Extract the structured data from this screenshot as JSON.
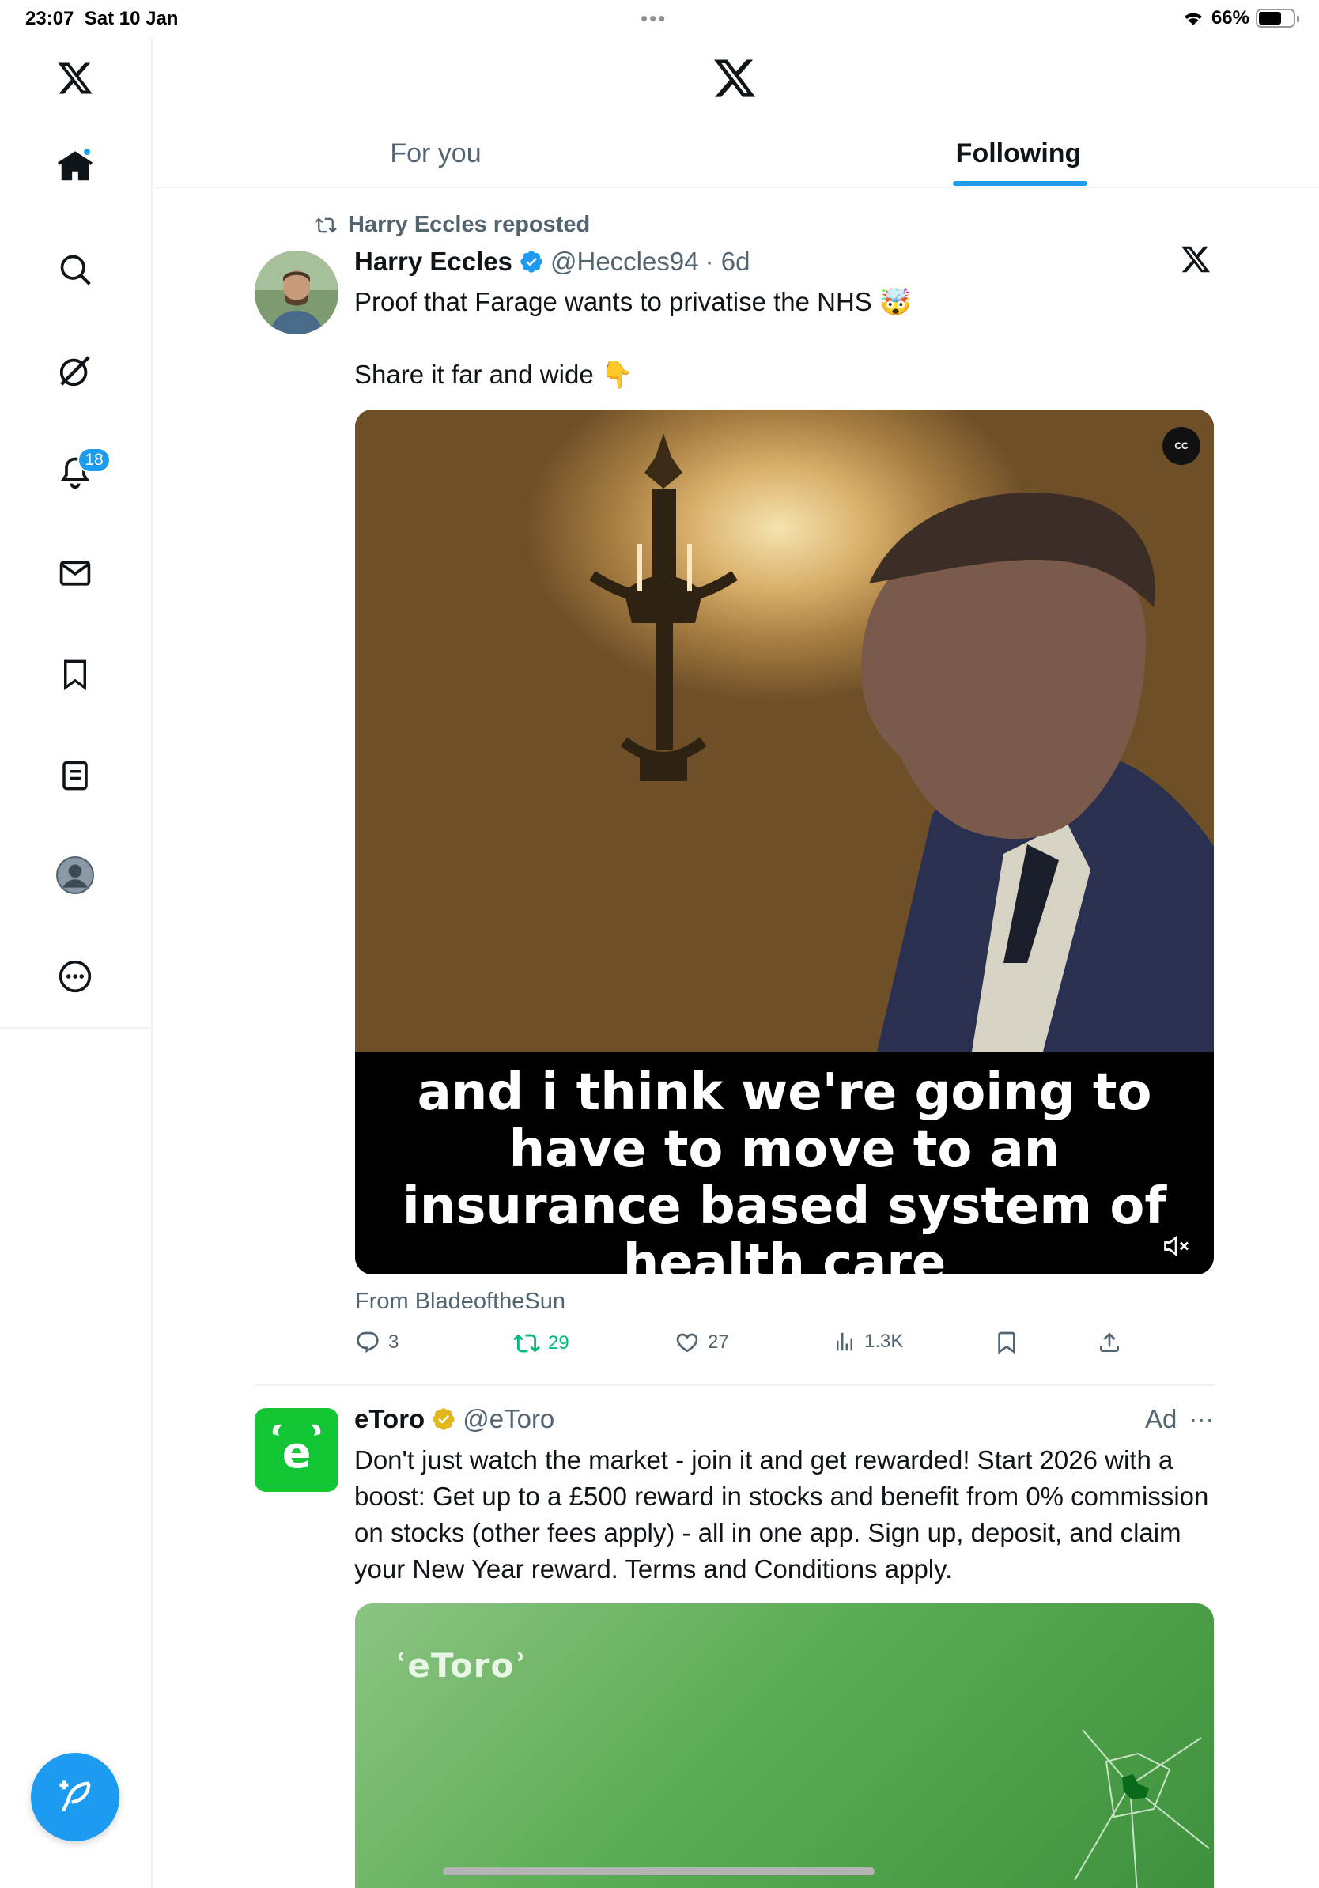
{
  "status_bar": {
    "time": "23:07",
    "date": "Sat 10 Jan",
    "battery": "66%",
    "battery_level": 0.66
  },
  "sidebar": {
    "items": [
      {
        "name": "logo",
        "icon": "x-logo-icon"
      },
      {
        "name": "home",
        "icon": "home-icon",
        "has_dot": true
      },
      {
        "name": "explore",
        "icon": "search-icon"
      },
      {
        "name": "grok",
        "icon": "grok-icon"
      },
      {
        "name": "notifications",
        "icon": "bell-icon",
        "badge": "18"
      },
      {
        "name": "messages",
        "icon": "mail-icon"
      },
      {
        "name": "bookmarks",
        "icon": "bookmark-icon"
      },
      {
        "name": "lists",
        "icon": "list-icon"
      },
      {
        "name": "profile",
        "icon": "avatar-icon"
      },
      {
        "name": "more",
        "icon": "more-circle-icon"
      }
    ],
    "compose_icon": "compose-feather-icon"
  },
  "header": {
    "tabs": [
      {
        "label": "For you",
        "active": false
      },
      {
        "label": "Following",
        "active": true
      }
    ],
    "accent": "#1d9bf0"
  },
  "tweets": [
    {
      "repost_label": "Harry Eccles reposted",
      "author": "Harry Eccles",
      "handle": "@Heccles94",
      "time": "· 6d",
      "verified": true,
      "line1": "Proof that Farage wants to privatise the NHS 🤯",
      "line2": "Share it far and wide 👇",
      "video_caption": [
        "and i think we're going to",
        "have to move to an",
        "insurance based system of",
        "health care"
      ],
      "source": "From BladeoftheSun",
      "stats": {
        "replies": "3",
        "reposts": "29",
        "likes": "27",
        "views": "1.3K"
      }
    }
  ],
  "ad": {
    "author": "eToro",
    "handle": "@eToro",
    "label": "Ad",
    "more": "···",
    "body": "Don't just watch the market - join it and get rewarded! Start 2026 with a boost: Get up to a £500 reward in stocks and benefit from 0% commission on stocks (other fees apply) - all in one app. Sign up, deposit, and claim your New Year reward. Terms and Conditions apply.",
    "avatar_letter": "e",
    "media_logo": "ʿeToroʾ",
    "brand_color": "#13c636"
  }
}
